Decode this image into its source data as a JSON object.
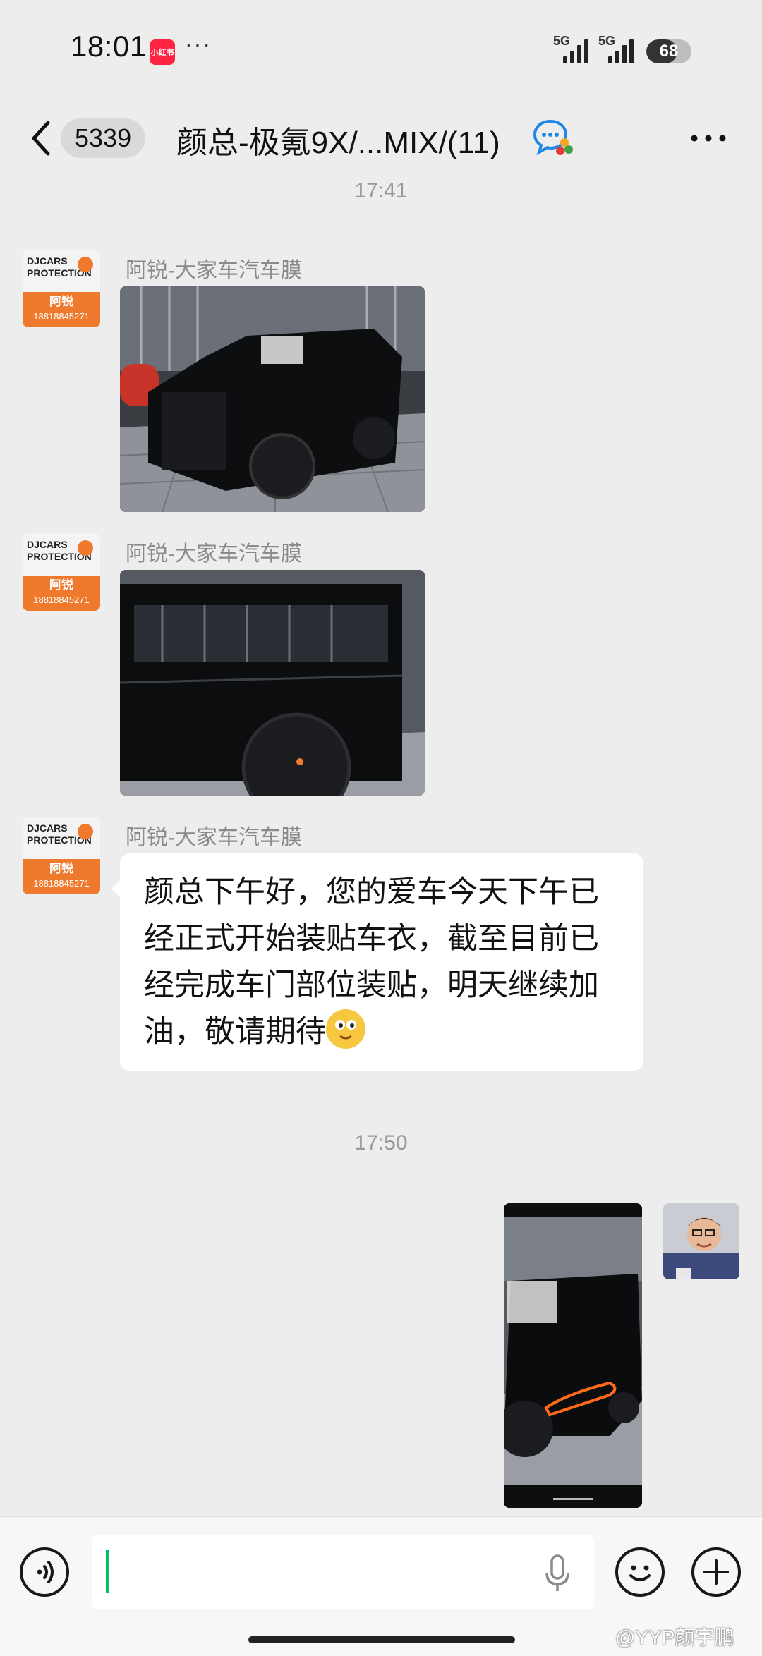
{
  "status_bar": {
    "time": "18:01",
    "app_badge": "小红书",
    "dots": "···",
    "signal_1": "5G",
    "signal_2": "5G",
    "battery": "68",
    "battery_level": 0.68
  },
  "nav": {
    "unread_count": "5339",
    "title": "颜总-极氪9X/...MIX/(11)"
  },
  "messages": {
    "time_1": "17:41",
    "time_2": "17:50",
    "sender_name": "阿锐-大家车汽车膜",
    "avatar": {
      "line1": "DJCARS",
      "line2": "PROTECTION",
      "name": "阿锐",
      "phone": "18818845271"
    },
    "text_message": "颜总下午好，您的爱车今天下午已经正式开始装贴车衣，截至目前已经完成车门部位装贴，明天继续加油，敬请期待"
  },
  "watermark": "@YYP颜宇鹏",
  "colors": {
    "background": "#ededed",
    "accent_orange": "#ef7a2d",
    "cursor_green": "#07c160",
    "annotation_orange": "#ff6a1a"
  }
}
